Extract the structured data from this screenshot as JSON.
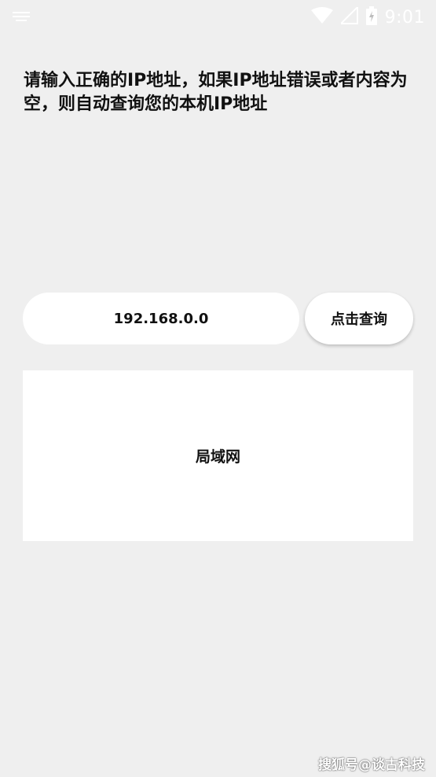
{
  "status_bar": {
    "time": "9:01",
    "left_icon": "notification-icon",
    "wifi_icon": "wifi-icon",
    "signal_icon": "cellular-signal-icon",
    "battery_icon": "battery-charging-icon",
    "icon_color": "#ffffff"
  },
  "main": {
    "prompt": "请输入正确的IP地址，如果IP地址错误或者内容为空，则自动查询您的本机IP地址",
    "ip_input": {
      "value": "192.168.0.0",
      "placeholder": ""
    },
    "query_button_label": "点击查询",
    "result_text": "局域网"
  },
  "watermark": "搜狐号@谈古科技",
  "colors": {
    "background": "#efefef",
    "surface": "#ffffff",
    "text": "#111111"
  }
}
